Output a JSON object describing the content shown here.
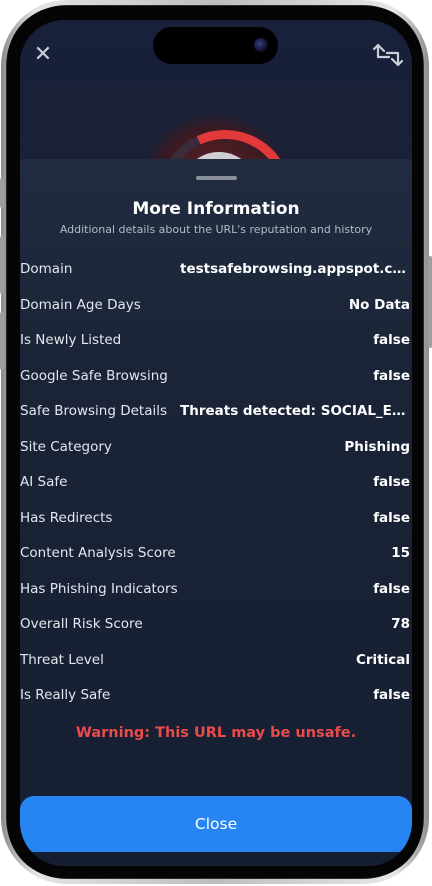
{
  "sheet": {
    "title": "More Information",
    "subtitle": "Additional details about the URL's reputation and history",
    "rows": [
      {
        "label": "Domain",
        "value": "testsafebrowsing.appspot.com"
      },
      {
        "label": "Domain Age Days",
        "value": "No Data"
      },
      {
        "label": "Is Newly Listed",
        "value": "false"
      },
      {
        "label": "Google Safe Browsing",
        "value": "false"
      },
      {
        "label": "Safe Browsing Details",
        "value": "Threats detected: SOCIAL_ENG..."
      },
      {
        "label": "Site Category",
        "value": "Phishing"
      },
      {
        "label": "AI Safe",
        "value": "false"
      },
      {
        "label": "Has Redirects",
        "value": "false"
      },
      {
        "label": "Content Analysis Score",
        "value": "15"
      },
      {
        "label": "Has Phishing Indicators",
        "value": "false"
      },
      {
        "label": "Overall Risk Score",
        "value": "78"
      },
      {
        "label": "Threat Level",
        "value": "Critical"
      },
      {
        "label": "Is Really Safe",
        "value": "false"
      }
    ],
    "warning": "Warning: This URL may be unsafe.",
    "close_label": "Close"
  },
  "icons": {
    "top_left": "close-icon",
    "top_right": "swap-icon"
  },
  "colors": {
    "accent": "#2685f2",
    "warning": "#ea4b4b",
    "sheet_bg": "#1b2437",
    "screen_bg": "#131a2e"
  }
}
